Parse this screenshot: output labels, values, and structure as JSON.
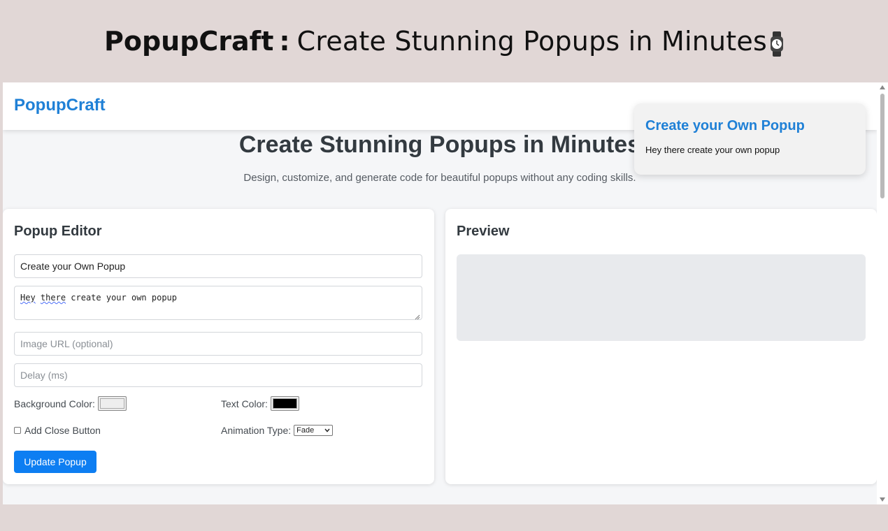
{
  "banner": {
    "brand": "PopupCraft",
    "separator": ":",
    "tagline": "Create Stunning Popups in Minutes",
    "icon": "watch-icon"
  },
  "nav": {
    "logo": "PopupCraft"
  },
  "hero": {
    "title": "Create Stunning Popups in Minutes",
    "subtitle": "Design, customize, and generate code for beautiful popups without any coding skills."
  },
  "editor": {
    "title": "Popup Editor",
    "title_value": "Create your Own Popup",
    "message_words": [
      "Hey",
      "there",
      "create your own popup"
    ],
    "image_placeholder": "Image URL (optional)",
    "delay_placeholder": "Delay (ms)",
    "bg_color_label": "Background Color:",
    "bg_color": "#eeeeee",
    "text_color_label": "Text Color:",
    "text_color": "#000000",
    "close_button_label": "Add Close Button",
    "close_button_checked": false,
    "animation_label": "Animation Type:",
    "animation_value": "Fade",
    "update_button": "Update Popup"
  },
  "preview": {
    "title": "Preview"
  },
  "popup": {
    "title": "Create your Own Popup",
    "message": "Hey there create your own popup"
  },
  "colors": {
    "accent": "#1f80d6",
    "button": "#0d7ef2",
    "banner_bg": "#e1d7d6"
  }
}
